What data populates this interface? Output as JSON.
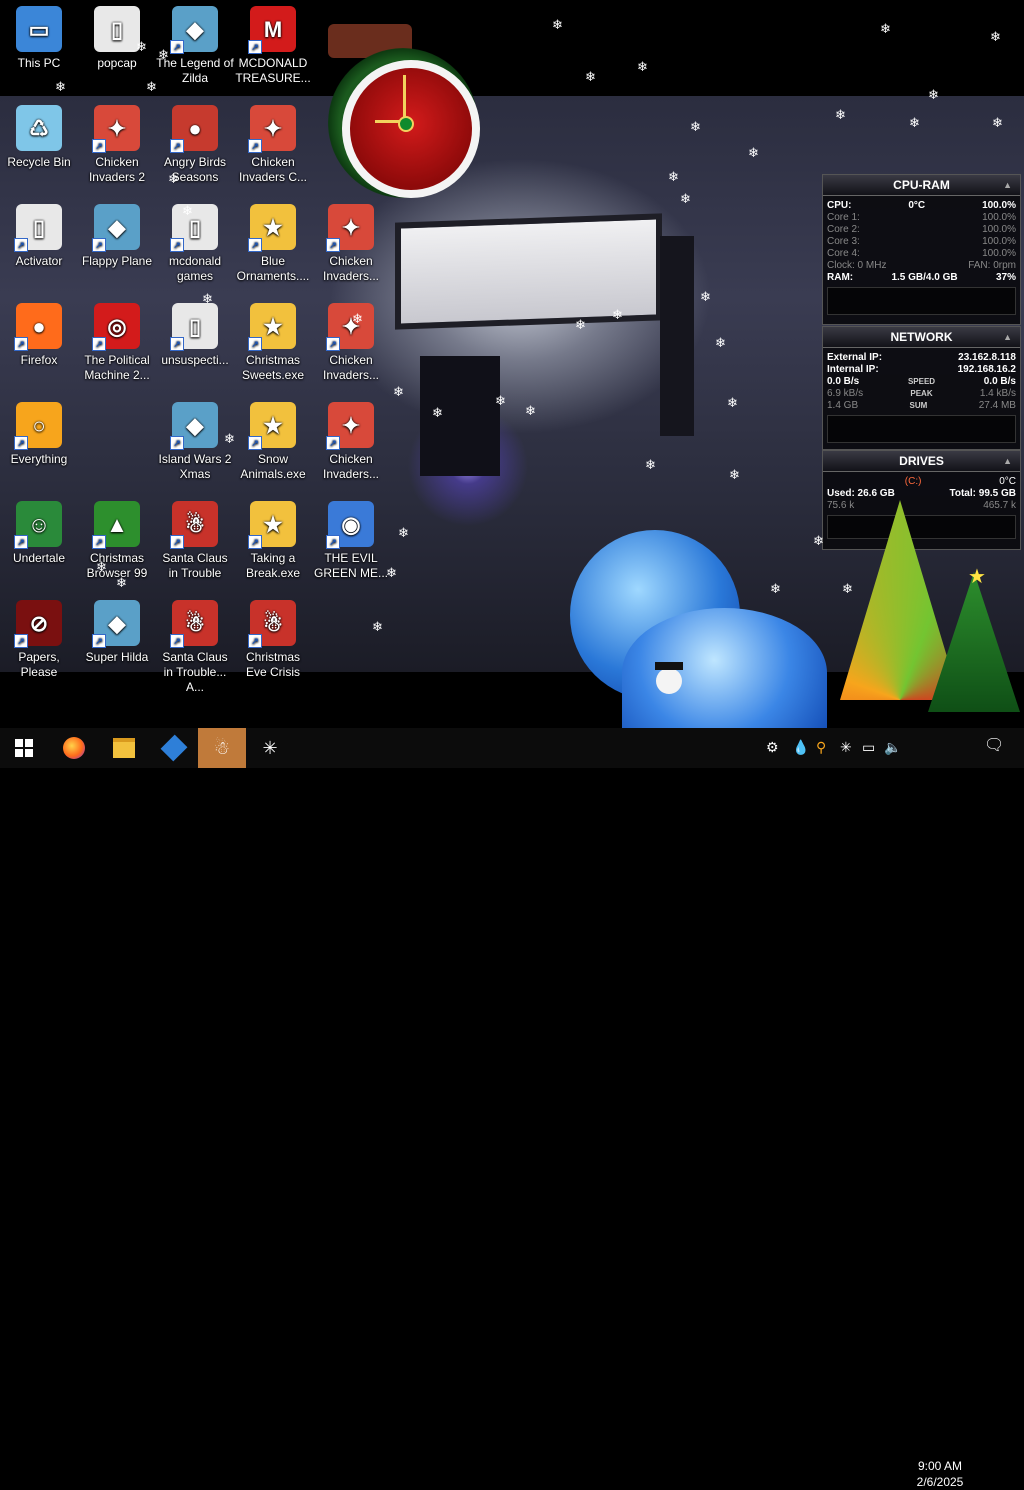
{
  "desktop": {
    "icons": [
      {
        "label": "This PC",
        "icon": "computer-icon"
      },
      {
        "label": "popcap",
        "icon": "folder-icon"
      },
      {
        "label": "The Legend of Zilda",
        "icon": "game-icon"
      },
      {
        "label": "MCDONALD TREASURE...",
        "icon": "mcdonalds-icon"
      },
      {
        "label": "Recycle Bin",
        "icon": "recycle-bin-icon"
      },
      {
        "label": "Chicken Invaders 2",
        "icon": "chicken-icon"
      },
      {
        "label": "Angry Birds Seasons",
        "icon": "angry-birds-icon"
      },
      {
        "label": "Chicken Invaders C...",
        "icon": "chicken-icon"
      },
      {
        "label": "Activator",
        "icon": "folder-icon"
      },
      {
        "label": "Flappy Plane",
        "icon": "game-icon"
      },
      {
        "label": "mcdonald games",
        "icon": "folder-icon"
      },
      {
        "label": "Blue Ornaments....",
        "icon": "exe-icon"
      },
      {
        "label": "Chicken Invaders...",
        "icon": "chicken-icon"
      },
      {
        "label": "Firefox",
        "icon": "firefox-icon"
      },
      {
        "label": "The Political Machine 2...",
        "icon": "political-machine-icon"
      },
      {
        "label": "unsuspecti...",
        "icon": "folder-icon"
      },
      {
        "label": "Christmas Sweets.exe",
        "icon": "exe-icon"
      },
      {
        "label": "Chicken Invaders...",
        "icon": "chicken-icon"
      },
      {
        "label": "Everything",
        "icon": "search-icon"
      },
      {
        "label": "Island Wars 2 Xmas",
        "icon": "game-icon"
      },
      {
        "label": "Snow Animals.exe",
        "icon": "exe-icon"
      },
      {
        "label": "Chicken Invaders...",
        "icon": "chicken-icon"
      },
      {
        "label": "Undertale",
        "icon": "undertale-icon"
      },
      {
        "label": "Christmas Browser 99",
        "icon": "tree-icon"
      },
      {
        "label": "Santa Claus in Trouble",
        "icon": "santa-icon"
      },
      {
        "label": "Taking a Break.exe",
        "icon": "exe-icon"
      },
      {
        "label": "THE EVIL GREEN ME...",
        "icon": "messenger-icon"
      },
      {
        "label": "Papers, Please",
        "icon": "papers-please-icon"
      },
      {
        "label": "Super Hilda",
        "icon": "game-icon"
      },
      {
        "label": "Santa Claus in Trouble... A...",
        "icon": "santa-icon"
      },
      {
        "label": "Christmas Eve Crisis",
        "icon": "santa-icon"
      }
    ]
  },
  "cpu_ram": {
    "title": "CPU-RAM",
    "cpu_label": "CPU:",
    "cpu_temp": "0°C",
    "cpu_value": "100.0%",
    "cores": [
      {
        "label": "Core 1:",
        "value": "100.0%"
      },
      {
        "label": "Core 2:",
        "value": "100.0%"
      },
      {
        "label": "Core 3:",
        "value": "100.0%"
      },
      {
        "label": "Core 4:",
        "value": "100.0%"
      }
    ],
    "clock_label": "Clock: 0 MHz",
    "fan_label": "FAN: 0rpm",
    "ram_label": "RAM:",
    "ram_value": "1.5 GB/4.0 GB",
    "ram_percent": "37%"
  },
  "network": {
    "title": "NETWORK",
    "external_label": "External IP:",
    "external_ip": "23.162.8.118",
    "internal_label": "Internal IP:",
    "internal_ip": "192.168.16.2",
    "speed_left": "0.0 B/s",
    "speed_label": "SPEED",
    "speed_right": "0.0 B/s",
    "peak_left": "6.9 kB/s",
    "peak_label": "PEAK",
    "peak_right": "1.4 kB/s",
    "sum_left": "1.4 GB",
    "sum_label": "SUM",
    "sum_right": "27.4 MB"
  },
  "drives": {
    "title": "DRIVES",
    "drive": "(C:)",
    "temp": "0°C",
    "used": "Used: 26.6 GB",
    "total": "Total: 99.5 GB",
    "read": "75.6 k",
    "write": "465.7 k"
  },
  "taskbar": {
    "time": "9:00 AM",
    "date": "2/6/2025",
    "apps": [
      "windows-start-icon",
      "firefox-icon",
      "file-explorer-icon",
      "app-icon",
      "christmas-app-icon",
      "snowflake-icon"
    ],
    "tray": [
      "network-monitor-icon",
      "droplet-icon",
      "search-tray-icon",
      "snowflake-tray-icon",
      "network-icon",
      "volume-muted-icon",
      "notification-icon"
    ]
  }
}
